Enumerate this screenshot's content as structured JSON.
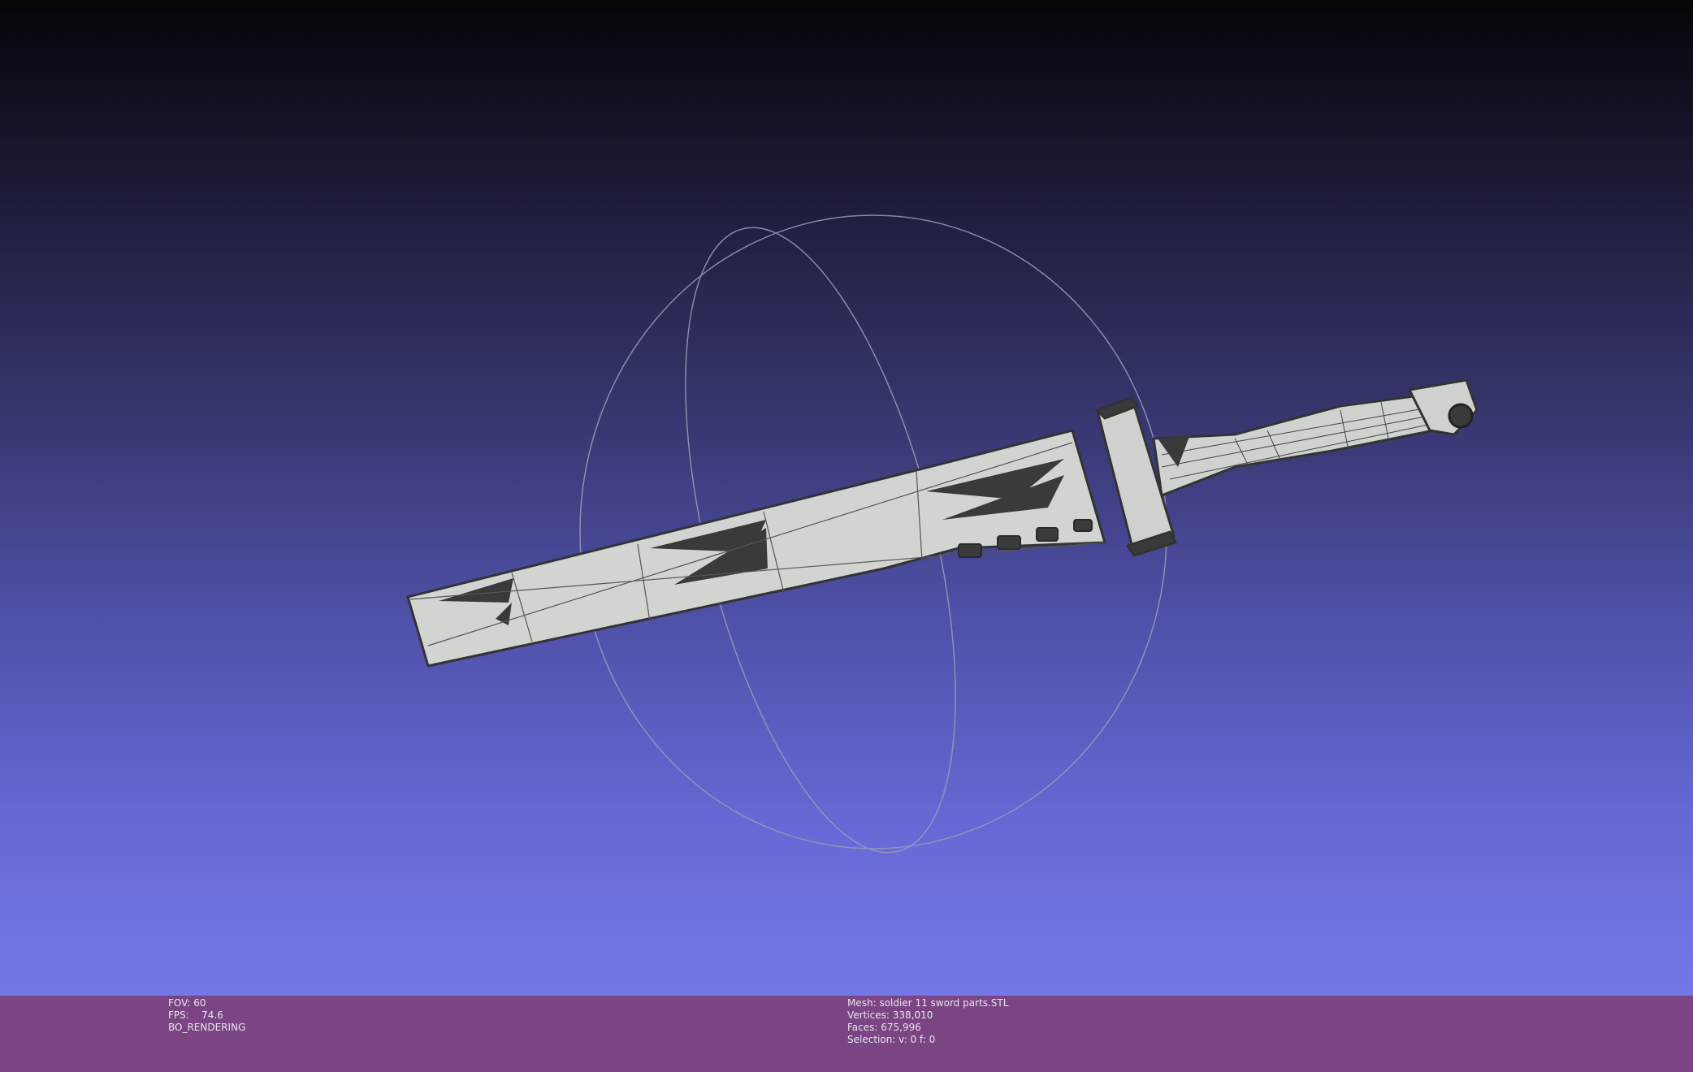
{
  "viewport": {
    "background_top": "#050508",
    "background_bottom": "#7377e8",
    "model_fill": "#d4d6d4",
    "model_edge": "#333333",
    "trackball_color": "#9a9ab8"
  },
  "status": {
    "left": {
      "fov": "FOV: 60",
      "fps": "FPS:    74.6",
      "mode": "BO_RENDERING"
    },
    "right": {
      "mesh": "Mesh: soldier 11 sword parts.STL",
      "vertices": "Vertices: 338,010",
      "faces": "Faces: 675,996",
      "selection": "Selection: v: 0 f: 0"
    },
    "bar_color": "#7b4583"
  }
}
